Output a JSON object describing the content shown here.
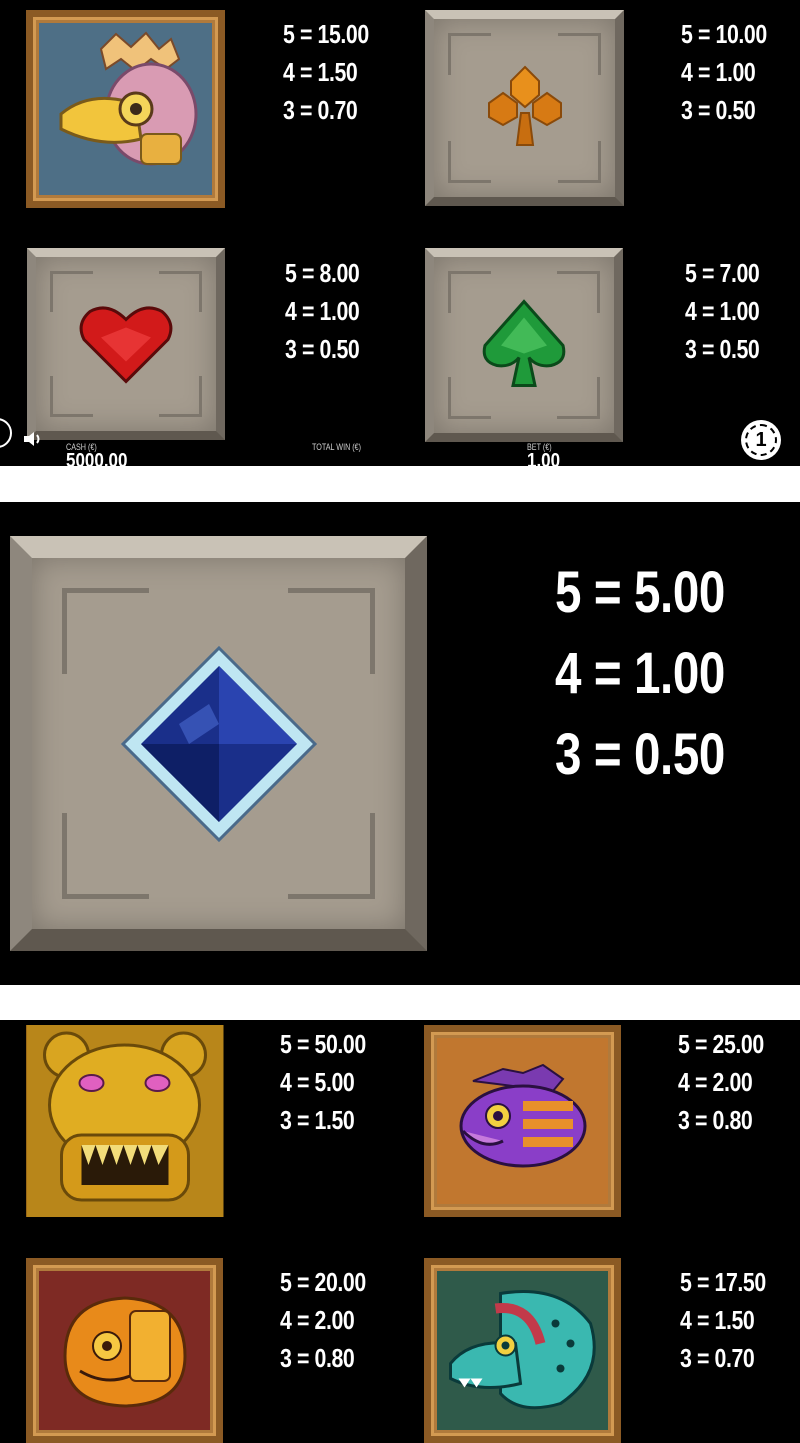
{
  "colors": {
    "background": "#000000",
    "separator": "#ffffff",
    "text": "#ffffff"
  },
  "page1": {
    "symbols": [
      {
        "name": "quetzal-bird-symbol",
        "frame": "wood",
        "pays": [
          "5 = 15.00",
          "4 = 1.50",
          "3 = 0.70"
        ]
      },
      {
        "name": "orange-club-gem-symbol",
        "frame": "stone",
        "pays": [
          "5 = 10.00",
          "4 = 1.00",
          "3 = 0.50"
        ]
      },
      {
        "name": "red-heart-gem-symbol",
        "frame": "stone",
        "pays": [
          "5 = 8.00",
          "4 = 1.00",
          "3 = 0.50"
        ]
      },
      {
        "name": "green-spade-gem-symbol",
        "frame": "stone",
        "pays": [
          "5 = 7.00",
          "4 = 1.00",
          "3 = 0.50"
        ]
      }
    ],
    "bottom_bar": {
      "cash_label": "CASH (€)",
      "cash_value": "5000.00",
      "total_win_label": "TOTAL WIN (€)",
      "bet_label": "BET (€)",
      "bet_value": "1.00",
      "coin_value": "1"
    }
  },
  "page2": {
    "symbol": {
      "name": "blue-diamond-gem-symbol",
      "frame": "stone",
      "pays": [
        "5 = 5.00",
        "4 = 1.00",
        "3 = 0.50"
      ]
    }
  },
  "page3": {
    "symbols": [
      {
        "name": "golden-jaguar-symbol",
        "frame": "gold",
        "pays": [
          "5 = 50.00",
          "4 = 5.00",
          "3 = 1.50"
        ]
      },
      {
        "name": "purple-fish-symbol",
        "frame": "wood",
        "pays": [
          "5 = 25.00",
          "4 = 2.00",
          "3 = 0.80"
        ]
      },
      {
        "name": "orange-monkey-symbol",
        "frame": "wood",
        "pays": [
          "5 = 20.00",
          "4 = 2.00",
          "3 = 0.80"
        ]
      },
      {
        "name": "teal-serpent-symbol",
        "frame": "wood",
        "pays": [
          "5 = 17.50",
          "4 = 1.50",
          "3 = 0.70"
        ]
      }
    ]
  }
}
